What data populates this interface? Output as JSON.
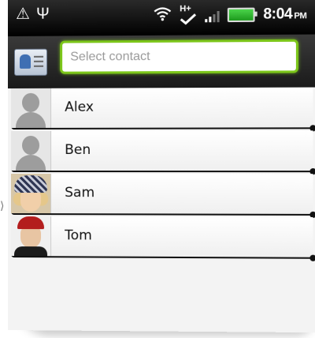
{
  "status_bar": {
    "time": "8:04",
    "time_suffix": "PM",
    "network_label": "H+",
    "left_icons": [
      "warning-icon",
      "usb-icon"
    ],
    "right_icons": [
      "wifi-icon",
      "h-plus-icon",
      "signal-icon",
      "battery-icon"
    ],
    "battery_color": "#2fbf2f"
  },
  "search": {
    "placeholder": "Select contact",
    "value": "",
    "accent": "#7cc61a"
  },
  "contacts": [
    {
      "name": "Alex",
      "avatar": "generic"
    },
    {
      "name": "Ben",
      "avatar": "generic"
    },
    {
      "name": "Sam",
      "avatar": "photo"
    },
    {
      "name": "Tom",
      "avatar": "photo"
    }
  ]
}
